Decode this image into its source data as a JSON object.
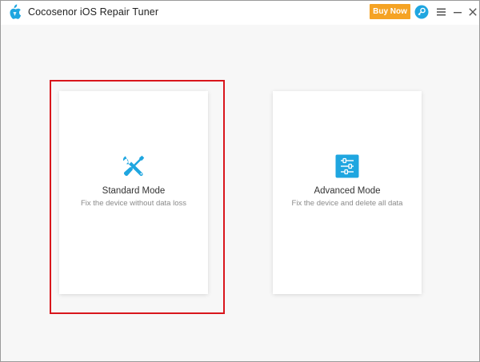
{
  "window": {
    "title": "Cocosenor iOS Repair Tuner"
  },
  "toolbar": {
    "buy_label": "Buy Now",
    "icons": [
      "key-icon",
      "menu-icon",
      "minimize-icon",
      "close-icon"
    ]
  },
  "modes": [
    {
      "title": "Standard Mode",
      "description": "Fix the device without data loss",
      "icon": "tools-icon"
    },
    {
      "title": "Advanced Mode",
      "description": "Fix the device and delete all data",
      "icon": "sliders-icon"
    }
  ],
  "colors": {
    "accent": "#1fa6e0",
    "buy": "#f5a324",
    "highlight": "#d9161c"
  }
}
